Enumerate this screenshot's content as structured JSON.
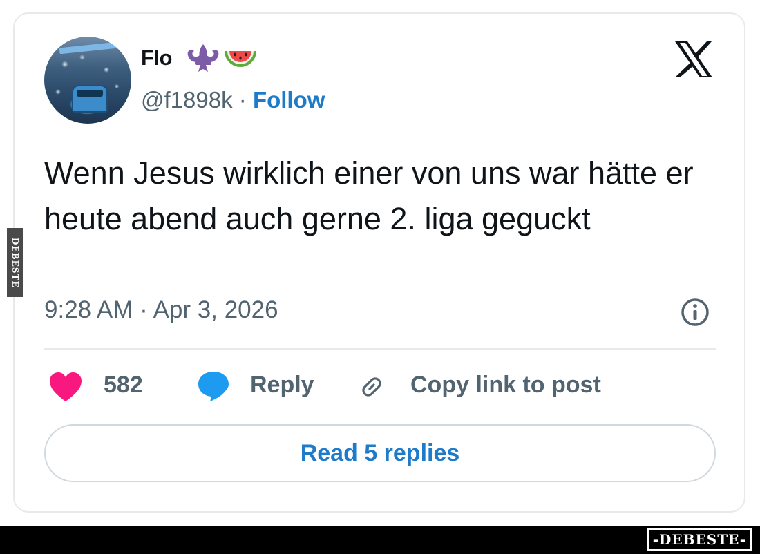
{
  "tweet": {
    "author_name": "Flo",
    "handle": "@f1898k",
    "separator": "·",
    "follow_label": "Follow",
    "text": "Wenn Jesus wirklich einer von uns war hätte er heute abend auch gerne 2. liga geguckt",
    "timestamp": "9:28 AM · Apr 3, 2026"
  },
  "actions": {
    "likes_count": "582",
    "reply_label": "Reply",
    "copy_link_label": "Copy link to post"
  },
  "read_replies_label": "Read 5 replies",
  "icons": {
    "fleur": "fleur-de-lis-icon",
    "watermelon": "watermelon-icon",
    "platform": "x-logo-icon",
    "info": "info-icon",
    "like": "heart-icon",
    "reply": "reply-bubble-icon",
    "link": "link-icon"
  },
  "colors": {
    "heart": "#f91880",
    "reply": "#1d9bf0",
    "follow": "#1d7bc9",
    "fleur": "#7d5ba6"
  },
  "watermark": {
    "side": "DEBESTE",
    "bottom": "-DEBESTE-"
  }
}
